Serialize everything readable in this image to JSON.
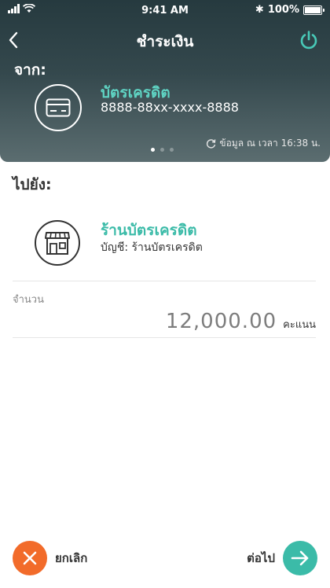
{
  "status_bar": {
    "time": "9:41 AM",
    "battery": "100%"
  },
  "header": {
    "title": "ชำระเงิน"
  },
  "from": {
    "label": "จาก:",
    "card_name": "บัตรเครดิต",
    "card_number": "8888-88xx-xxxx-8888",
    "updated_text": "ข้อมูล ณ เวลา 16:38 น.",
    "pager": {
      "count": 3,
      "active": 1
    }
  },
  "to": {
    "label": "ไปยัง:",
    "merchant_name": "ร้านบัตรเครดิต",
    "account_text": "บัญชี: ร้านบัตรเครดิต"
  },
  "amount": {
    "label": "จำนวน",
    "value": "12,000.00",
    "unit": "คะแนน"
  },
  "footer": {
    "cancel_label": "ยกเลิก",
    "next_label": "ต่อไป"
  },
  "colors": {
    "accent": "#3bbba8",
    "cancel": "#f26b2a",
    "header_dark": "#263a3f"
  }
}
